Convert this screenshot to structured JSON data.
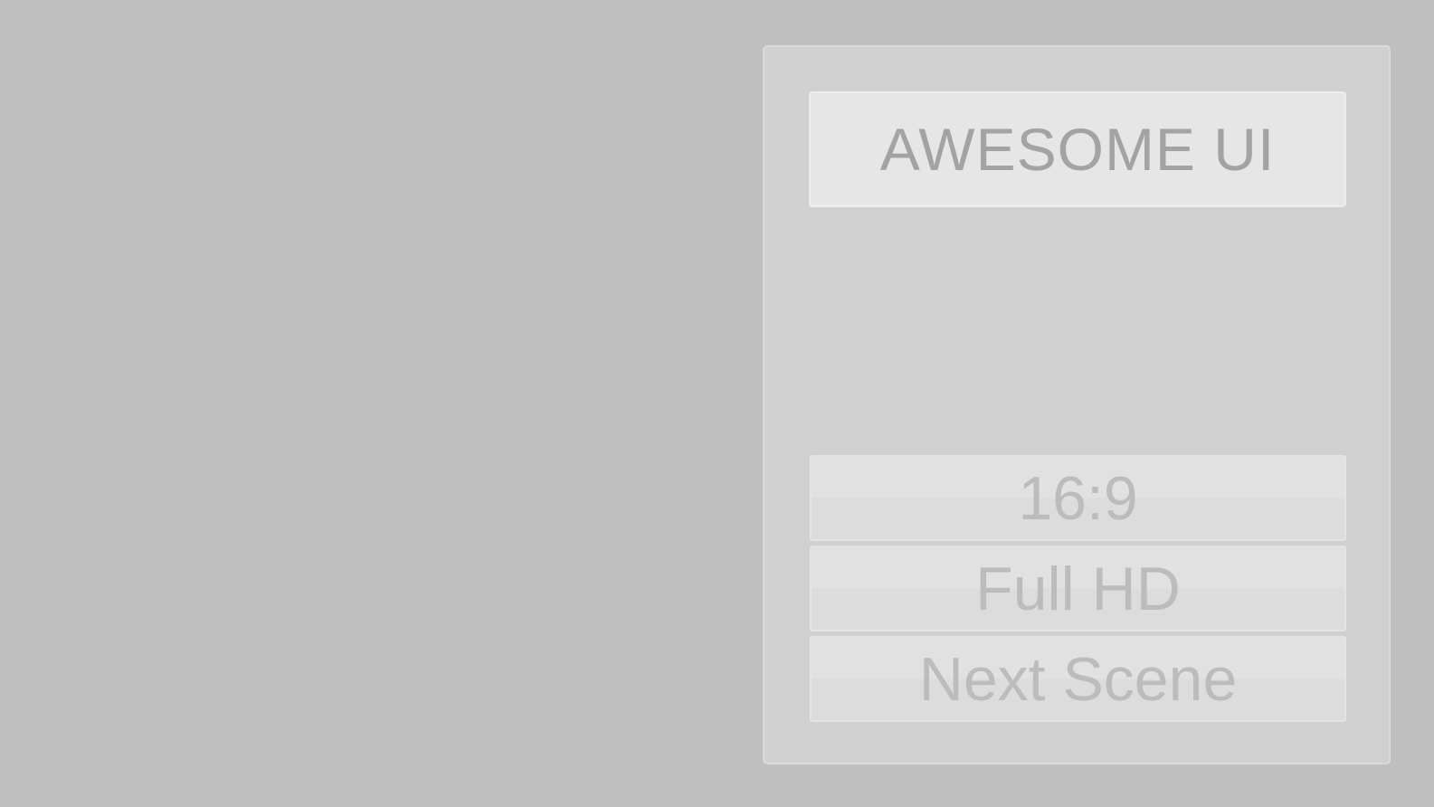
{
  "panel": {
    "title": "AWESOME UI",
    "buttons": [
      {
        "label": "16:9"
      },
      {
        "label": "Full HD"
      },
      {
        "label": "Next Scene"
      }
    ]
  },
  "colors": {
    "background": "#bfbfbf",
    "panel": "#d0d0d0",
    "title_box": "#e6e6e6",
    "title_text": "#a3a3a3",
    "button": "#e0e0e0",
    "button_text": "#bcbcbc"
  }
}
